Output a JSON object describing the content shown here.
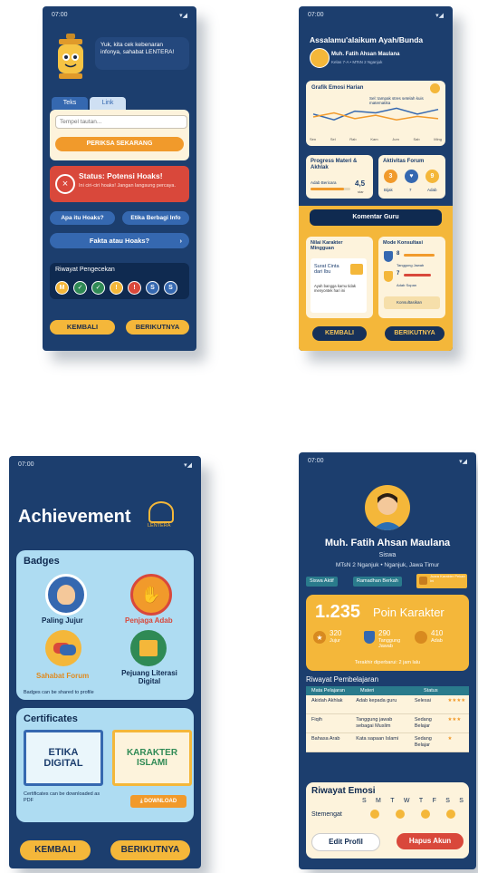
{
  "colors": {
    "navy": "#1c3e6e",
    "gold": "#f4b73a",
    "red": "#d9483b",
    "cream": "#fdf3dc",
    "blue": "#3568b0",
    "lightblue": "#aedcf2"
  },
  "s1": {
    "time": "07:00",
    "speech": "Yuk, kita cek kebenaran infonya, sahabat LENTERA!",
    "tab_text": "Teks",
    "tab_link": "Link",
    "url_placeholder": "Tempel tautan...",
    "check_btn": "PERIKSA SEKARANG",
    "status_title": "Status: Potensi Hoaks!",
    "status_desc": "Ini ciri-ciri hoaks! Jangan langsung percaya.",
    "btn_what": "Apa itu Hoaks?",
    "btn_ethics": "Etika Berbagi Info",
    "btn_fact": "Fakta atau Hoaks?",
    "history_title": "Riwayat Pengecekan",
    "history": [
      "M",
      "✓",
      "✓",
      "!",
      "!",
      "S",
      "S"
    ],
    "back": "KEMBALI",
    "next": "BERIKUTNYA"
  },
  "s2": {
    "time": "07:00",
    "greeting": "Assalamu'alaikum Ayah/Bunda",
    "student": "Muh. Fatih Ahsan Maulana",
    "student_sub": "Kelas 7-A • MTsN 2 Nganjuk",
    "emotion_title": "Grafik Emosi Harian",
    "emotion_note": "Sel: tampak stres setelah kuis matematika",
    "days": [
      "Sen",
      "Sel",
      "Rab",
      "Kam",
      "Jum",
      "Sab",
      "Ming"
    ],
    "chart_data": {
      "type": "line",
      "categories": [
        "Sen",
        "Sel",
        "Rab",
        "Kam",
        "Jum",
        "Sab",
        "Ming"
      ],
      "series": [
        {
          "values": [
            3,
            2,
            3.5,
            3.2,
            4,
            3,
            3.8
          ]
        },
        {
          "values": [
            2.5,
            3.2,
            2.2,
            2.8,
            2,
            2.6,
            2.2
          ]
        }
      ],
      "ylim": [
        0,
        5
      ]
    },
    "progress_title": "Progress Materi & Akhlak",
    "progress_label": "Adab Bericara",
    "progress_value": "4,5",
    "progress_unit": "star",
    "forum_title": "Aktivitas Forum",
    "forum_nums": [
      "3",
      "7",
      "9"
    ],
    "forum_labels": [
      "Bijak",
      "7",
      "Adab"
    ],
    "comment_btn": "Komentar Guru",
    "weekly_title": "Nilai Karakter Mingguan",
    "letter_title": "Surat Cinta dari Ibu",
    "letter_text": "Ayah bangga kamu tidak menyontek hari ini",
    "mode_title": "Mode Konsultasi",
    "mode_nums": [
      "8",
      "7"
    ],
    "mode_labels": [
      "Tanggung Jawab",
      "Adab Sopan"
    ],
    "consult": "Konsultasikan",
    "back": "KEMBALI",
    "next": "BERIKUTNYA"
  },
  "s3": {
    "time": "07:00",
    "title": "Achievement",
    "logo_text": "LENTERA",
    "badges_title": "Badges",
    "badges": [
      "Paling Jujur",
      "Penjaga Adab",
      "Sahabat Forum",
      "Pejuang Literasi Digital"
    ],
    "badges_note": "Badges can be shared to profile",
    "cert_title": "Certificates",
    "cert1": "ETIKA DIGITAL",
    "cert2": "KARAKTER ISLAMI",
    "cert_note": "Certificates can be downloaded as PDF",
    "download": "DOWNLOAD",
    "back": "KEMBALI",
    "next": "BERIKUTNYA"
  },
  "s4": {
    "time": "07:00",
    "name": "Muh. Fatih Ahsan Maulana",
    "role": "Siswa",
    "school": "MTsN 2 Nganjuk • Nganjuk, Jawa Timur",
    "tags": [
      "Siswa Aktif",
      "Ramadhan Berkah",
      "Juara Karakter Pekan Ini"
    ],
    "points": "1.235",
    "points_label": "Poin Karakter",
    "stats": [
      {
        "n": "320",
        "l": "Jujur"
      },
      {
        "n": "290",
        "l": "Tanggung Jawab"
      },
      {
        "n": "410",
        "l": "Adab"
      }
    ],
    "updated": "Terakhir diperbarui: 2 jam lalu",
    "history_title": "Riwayat Pembelajaran",
    "table_headers": [
      "Mata Pelajaran",
      "Materi",
      "Status"
    ],
    "table_rows": [
      [
        "Akidah Akhlak",
        "Adab kepada guru",
        "Selesai",
        "★★★★"
      ],
      [
        "Fiqih",
        "Tanggung jawab sebagai Muslim",
        "Sedang Belajar",
        "★★★"
      ],
      [
        "Bahasa Arab",
        "Kata sapaan Islami",
        "Sedang Belajar",
        "★"
      ]
    ],
    "emotion_title": "Riwayat Emosi",
    "days": [
      "S",
      "M",
      "T",
      "W",
      "T",
      "F",
      "S",
      "S"
    ],
    "mood_label": "Stemengat",
    "edit": "Edit Profil",
    "delete": "Hapus Akun"
  }
}
